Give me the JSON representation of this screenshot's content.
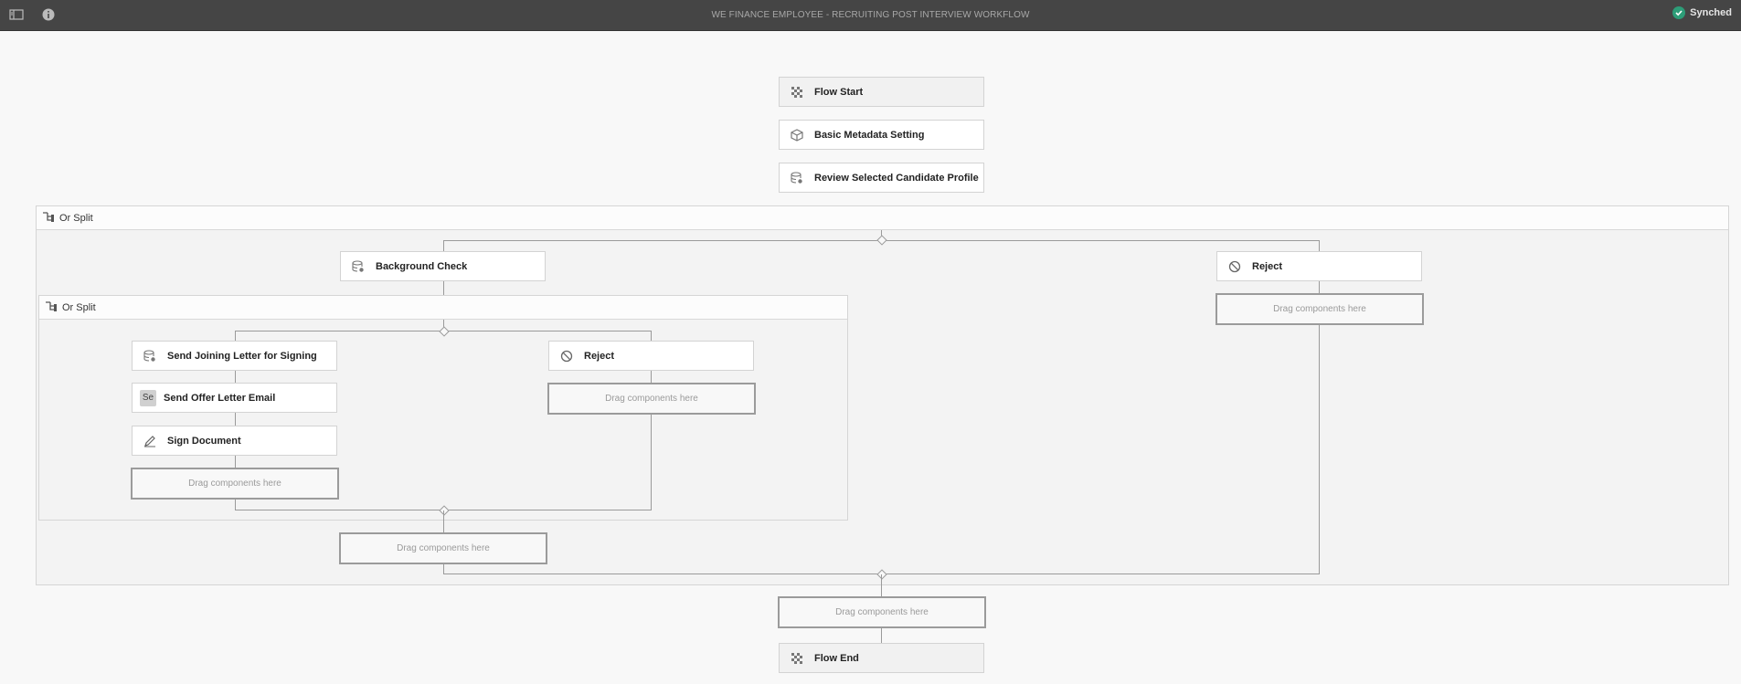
{
  "app": {
    "title": "WE FINANCE EMPLOYEE - RECRUITING POST INTERVIEW WORKFLOW",
    "sync_status": "Synched",
    "icons": {
      "left_panel": "side-panel-icon",
      "info": "info-icon",
      "synced": "check-circle-icon"
    },
    "colors": {
      "toolbar": "#454545",
      "canvas": "#f8f8f8",
      "synced": "#2d9d78"
    }
  },
  "flow": {
    "start": "Flow Start",
    "metadata": "Basic Metadata Setting",
    "review": "Review Selected Candidate Profile",
    "end": "Flow End"
  },
  "outer_split": {
    "label": "Or Split",
    "left_branch": {
      "background_check": "Background Check",
      "drop": "Drag components here"
    },
    "right_branch": {
      "reject": "Reject",
      "drop": "Drag components here"
    }
  },
  "inner_split": {
    "label": "Or Split",
    "left_branch": {
      "joining_letter": "Send Joining Letter for Signing",
      "offer_badge": "Se",
      "offer_email": "Send Offer Letter Email",
      "sign_document": "Sign Document",
      "drop": "Drag components here"
    },
    "right_branch": {
      "reject": "Reject",
      "drop": "Drag components here"
    }
  },
  "after_outer_drop": "Drag components here"
}
